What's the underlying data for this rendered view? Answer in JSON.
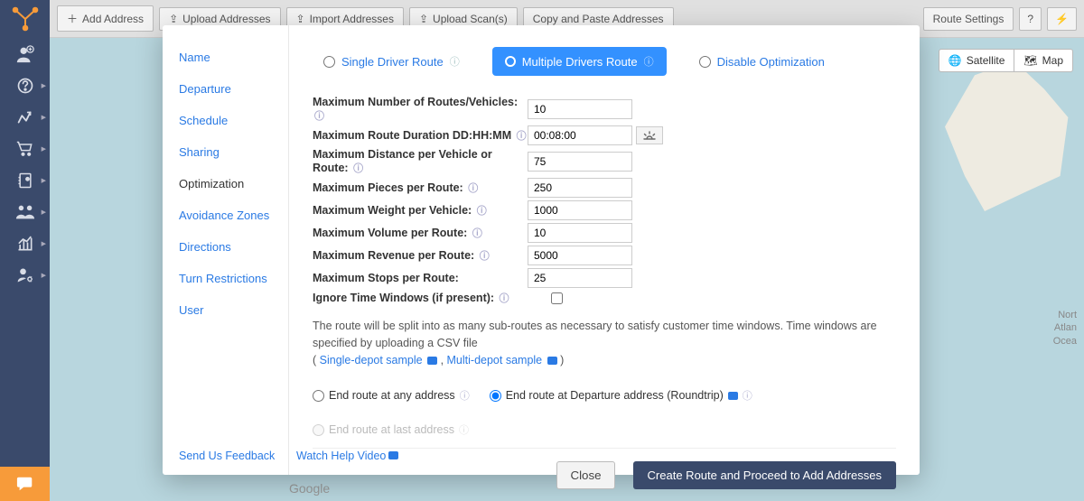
{
  "topbar": {
    "add_address": "Add Address",
    "upload_addresses": "Upload Addresses",
    "import_addresses": "Import Addresses",
    "upload_scans": "Upload Scan(s)",
    "copy_paste": "Copy and Paste Addresses",
    "route_settings": "Route Settings"
  },
  "map": {
    "satellite": "Satellite",
    "map": "Map",
    "ocean_label": "Nort\nAtlan\nOcea",
    "google": "Google"
  },
  "modal": {
    "nav": [
      "Name",
      "Departure",
      "Schedule",
      "Sharing",
      "Optimization",
      "Avoidance Zones",
      "Directions",
      "Turn Restrictions",
      "User"
    ],
    "active_nav": "Optimization",
    "opt_radios": {
      "single": "Single Driver Route",
      "multiple": "Multiple Drivers Route",
      "disable": "Disable Optimization"
    },
    "fields": {
      "max_routes": {
        "label": "Maximum Number of Routes/Vehicles:",
        "value": "10"
      },
      "max_duration": {
        "label": "Maximum Route Duration DD:HH:MM",
        "value": "00:08:00"
      },
      "max_distance": {
        "label": "Maximum Distance per Vehicle or Route:",
        "value": "75"
      },
      "max_pieces": {
        "label": "Maximum Pieces per Route:",
        "value": "250"
      },
      "max_weight": {
        "label": "Maximum Weight per Vehicle:",
        "value": "1000"
      },
      "max_volume": {
        "label": "Maximum Volume per Route:",
        "value": "10"
      },
      "max_revenue": {
        "label": "Maximum Revenue per Route:",
        "value": "5000"
      },
      "max_stops": {
        "label": "Maximum Stops per Route:",
        "value": "25"
      },
      "ignore_tw": {
        "label": "Ignore Time Windows (if present):"
      }
    },
    "desc": {
      "text": "The route will be split into as many sub-routes as necessary to satisfy customer time windows. Time windows are specified by uploading a CSV file",
      "single_depot": "Single-depot sample",
      "multi_depot": "Multi-depot sample"
    },
    "end_radios": {
      "any": "End route at any address",
      "departure": "End route at Departure address (Roundtrip)",
      "last": "End route at last address"
    },
    "footer": {
      "feedback": "Send Us Feedback",
      "watch": "Watch Help Video",
      "close": "Close",
      "create": "Create Route and Proceed to Add Addresses"
    }
  }
}
